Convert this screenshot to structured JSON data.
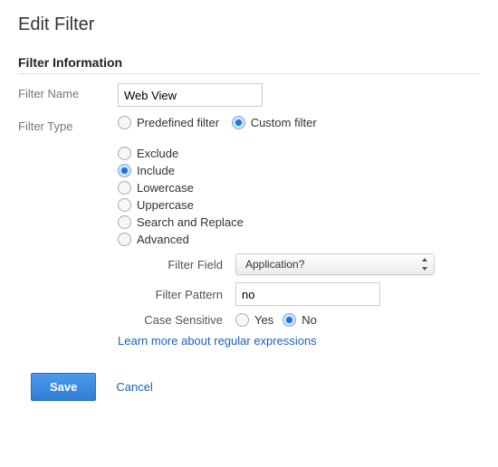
{
  "page_title": "Edit Filter",
  "section_title": "Filter Information",
  "labels": {
    "filter_name": "Filter Name",
    "filter_type": "Filter Type",
    "filter_field": "Filter Field",
    "filter_pattern": "Filter Pattern",
    "case_sensitive": "Case Sensitive"
  },
  "filter_name_value": "Web View",
  "filter_type": {
    "predefined": "Predefined filter",
    "custom": "Custom filter",
    "selected": "custom"
  },
  "custom_options": {
    "exclude": "Exclude",
    "include": "Include",
    "lowercase": "Lowercase",
    "uppercase": "Uppercase",
    "search_replace": "Search and Replace",
    "advanced": "Advanced",
    "selected": "include"
  },
  "filter_field_value": "Application?",
  "filter_pattern_value": "no",
  "case_sensitive": {
    "yes": "Yes",
    "no": "No",
    "selected": "no"
  },
  "learn_more": "Learn more about regular expressions",
  "buttons": {
    "save": "Save",
    "cancel": "Cancel"
  }
}
